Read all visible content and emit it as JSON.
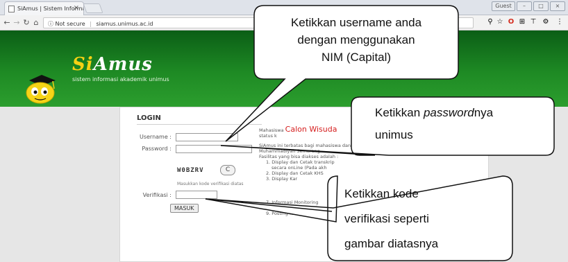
{
  "browser": {
    "tab_title": "SiAmus | Sistem Informa",
    "tab_close": "×",
    "user_chip": "Guest",
    "url_prefix": "Not secure",
    "url": "siamus.unimus.ac.id"
  },
  "site": {
    "logo_si": "Si",
    "logo_rest": "Amus",
    "subtitle": "sistem informasi akademik unimus"
  },
  "login": {
    "title": "LOGIN",
    "username_label": "Username :",
    "password_label": "Password :",
    "captcha": "W0BZRV",
    "refresh": "C",
    "verif_hint": "Masukkan kode verifikasi diatas",
    "verif_label": "Verifikasi :",
    "submit": "MASUK"
  },
  "info": {
    "line1_prefix": "Mahasiswa",
    "line1_highlight": "Calon Wisuda",
    "line2": "status k",
    "line3": "SiAmus ini terbatas bagi mahasiswa dan d",
    "line4": "Muhammadiyah Semarang.",
    "line5": "Fasilitas yang bisa diakses adalah :",
    "items": [
      "1. Display dan Cetak transkrip",
      "secara onLine (Pada akh",
      "2. Display dan Cetak KHS",
      "3. Display Kar",
      "7. Informasi Monitoring",
      "8. Entri Nilai dan Lapora",
      "9. Posting Kritik dan Sar"
    ]
  },
  "callouts": {
    "username": [
      "Ketikkan username anda",
      "dengan menggunakan",
      "NIM (Capital)"
    ],
    "password_prefix": "Ketikkan ",
    "password_italic": "password",
    "password_suffix": "nya",
    "password_line2": "unimus",
    "verif": [
      "Ketikkan kode",
      "verifikasi seperti",
      "gambar diatasnya"
    ]
  }
}
